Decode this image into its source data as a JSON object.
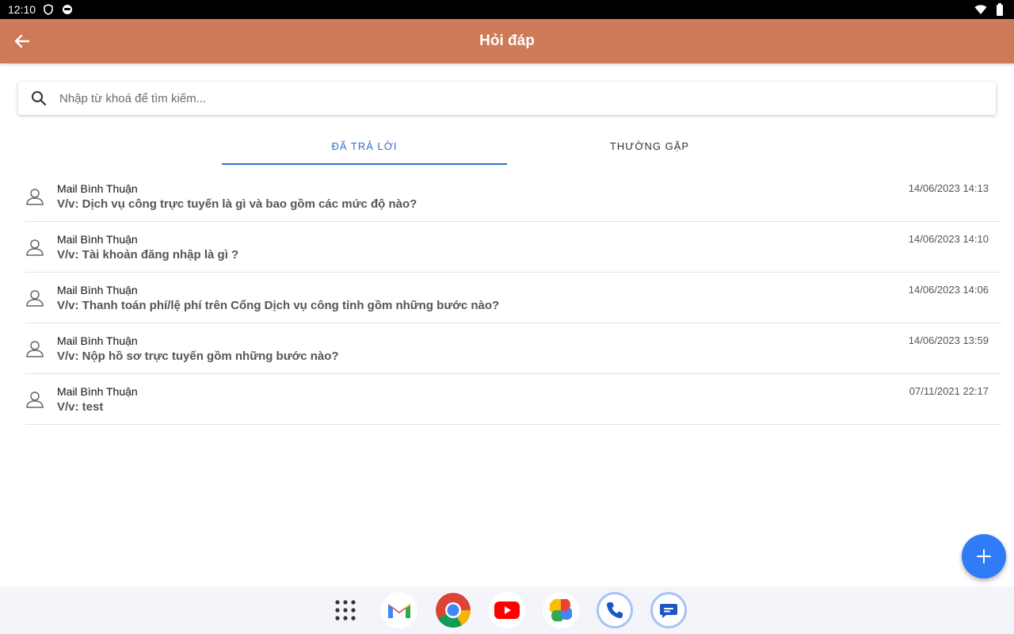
{
  "status_bar": {
    "time": "12:10"
  },
  "app_bar": {
    "title": "Hỏi đáp"
  },
  "search": {
    "placeholder": "Nhập từ khoá để tìm kiếm..."
  },
  "tabs": [
    {
      "label": "ĐÃ TRẢ LỜI",
      "active": true
    },
    {
      "label": "THƯỜNG GẶP",
      "active": false
    }
  ],
  "questions": [
    {
      "author": "Mail Bình Thuận",
      "subject": "V/v: Dịch vụ công trực tuyến là gì và bao gồm các mức độ nào?",
      "time": "14/06/2023 14:13"
    },
    {
      "author": "Mail Bình Thuận",
      "subject": "V/v: Tài khoản đăng nhập là gì ?",
      "time": "14/06/2023 14:10"
    },
    {
      "author": "Mail Bình Thuận",
      "subject": "V/v: Thanh toán phí/lệ phí trên Cổng Dịch vụ công tỉnh gồm những bước nào?",
      "time": "14/06/2023 14:06"
    },
    {
      "author": "Mail Bình Thuận",
      "subject": "V/v: Nộp hồ sơ trực tuyến gồm những bước nào?",
      "time": "14/06/2023 13:59"
    },
    {
      "author": "Mail Bình Thuận",
      "subject": "V/v: test",
      "time": "07/11/2021 22:17"
    }
  ],
  "colors": {
    "app_bar": "#cc7a57",
    "accent": "#2f6fd0",
    "fab": "#2f7cf6"
  },
  "dock": [
    "app-drawer-icon",
    "gmail-icon",
    "chrome-icon",
    "youtube-icon",
    "photos-icon",
    "phone-icon",
    "messages-icon"
  ]
}
